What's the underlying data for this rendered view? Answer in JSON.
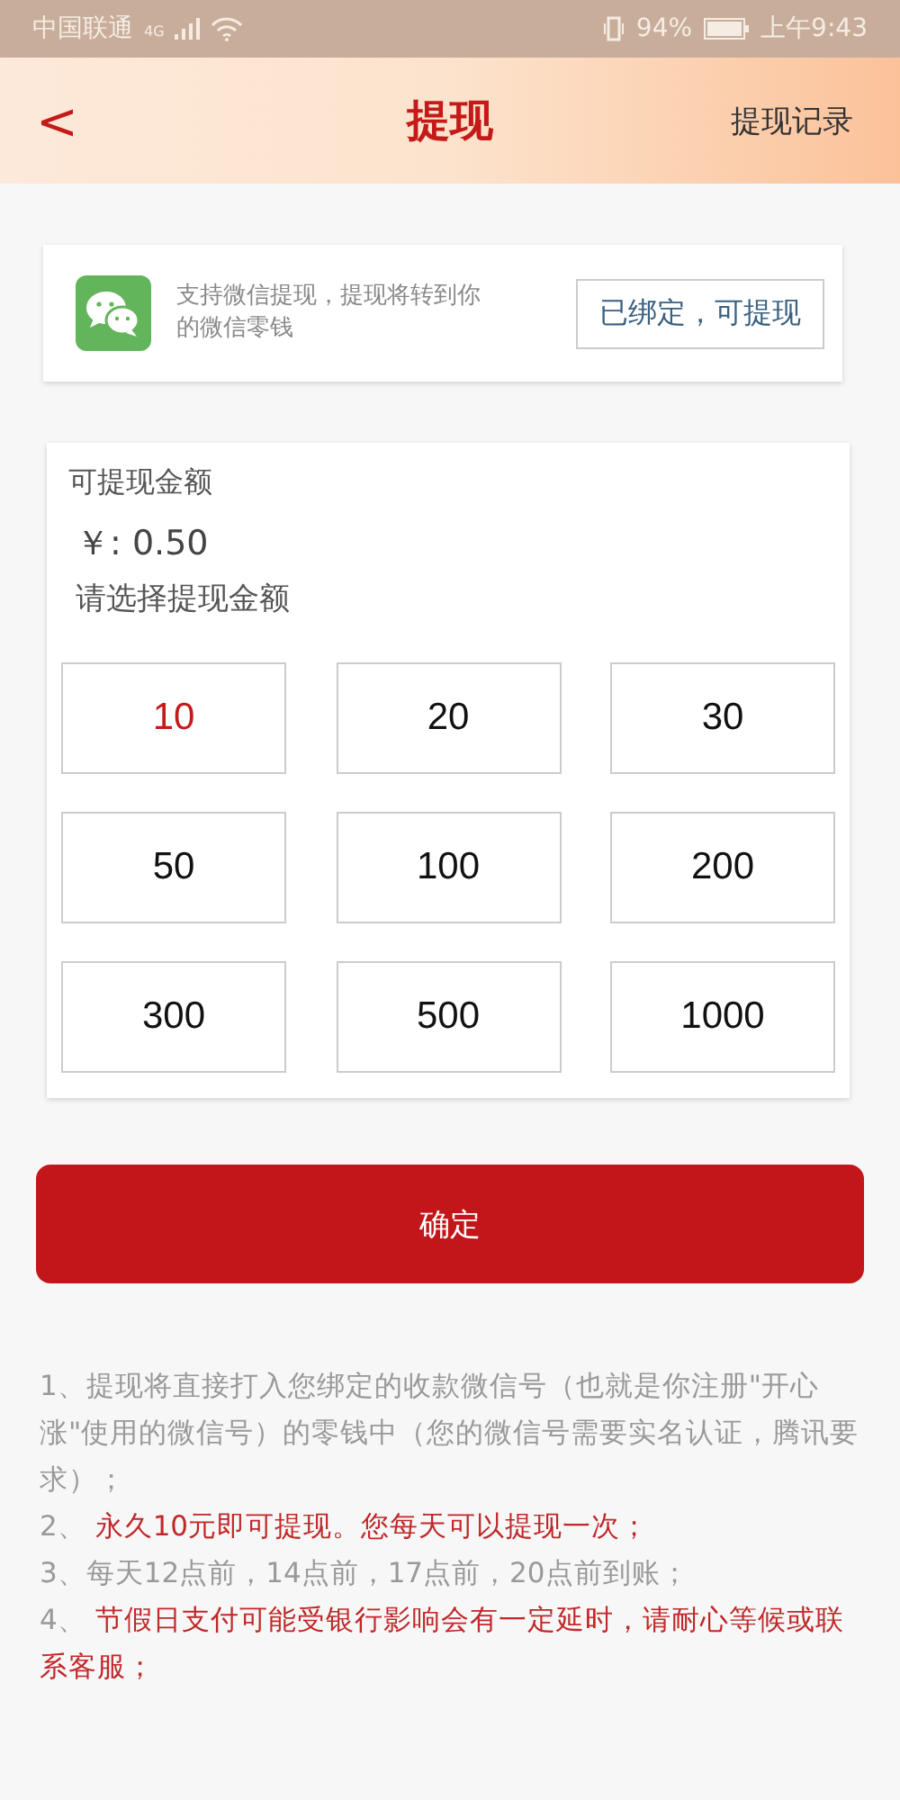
{
  "status_bar": {
    "carrier": "中国联通",
    "network": "4G",
    "battery": "94%",
    "time": "上午9:43"
  },
  "header": {
    "back": "<",
    "title": "提现",
    "action": "提现记录"
  },
  "wechat_card": {
    "description": "支持微信提现，提现将转到你的微信零钱",
    "status_button": "已绑定，可提现"
  },
  "amount_card": {
    "label": "可提现金额",
    "balance": "￥: 0.50",
    "prompt": "请选择提现金额",
    "options": [
      {
        "label": "10",
        "selected": true
      },
      {
        "label": "20",
        "selected": false
      },
      {
        "label": "30",
        "selected": false
      },
      {
        "label": "50",
        "selected": false
      },
      {
        "label": "100",
        "selected": false
      },
      {
        "label": "200",
        "selected": false
      },
      {
        "label": "300",
        "selected": false
      },
      {
        "label": "500",
        "selected": false
      },
      {
        "label": "1000",
        "selected": false
      }
    ]
  },
  "confirm_button": "确定",
  "notes": [
    {
      "number": "1、",
      "text": "提现将直接打入您绑定的收款微信号（也就是你注册\"开心涨\"使用的微信号）的零钱中（您的微信号需要实名认证，腾讯要求）；",
      "kind": "plain"
    },
    {
      "number": "2、",
      "text": "永久10元即可提现。您每天可以提现一次；",
      "kind": "highlight"
    },
    {
      "number": "3、",
      "text": "每天12点前，14点前，17点前，20点前到账；",
      "kind": "plain"
    },
    {
      "number": "4、",
      "text": "节假日支付可能受银行影响会有一定延时，请耐心等候或联系客服；",
      "kind": "highlight"
    }
  ]
}
